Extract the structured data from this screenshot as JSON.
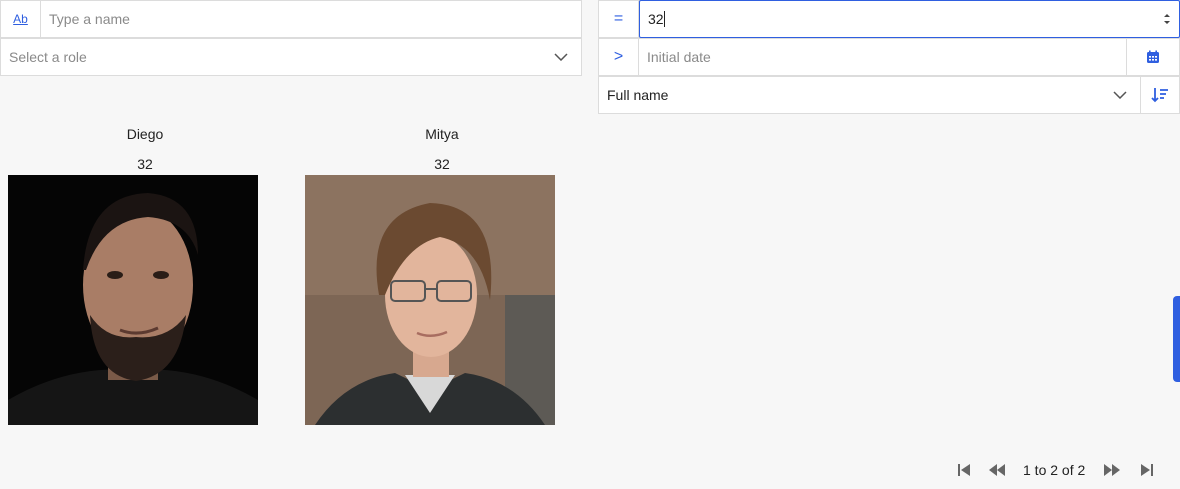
{
  "filters": {
    "name": {
      "placeholder": "Type a name",
      "prefix": "Ab"
    },
    "role": {
      "placeholder": "Select a role"
    },
    "age": {
      "operator": "=",
      "value": "32"
    },
    "date": {
      "operator": ">",
      "placeholder": "Initial date"
    },
    "sort": {
      "value": "Full name"
    }
  },
  "people": [
    {
      "name": "Diego",
      "age": "32"
    },
    {
      "name": "Mitya",
      "age": "32"
    }
  ],
  "pagination": {
    "label": "1 to 2 of 2"
  },
  "colors": {
    "accent": "#2f5fe0",
    "border": "#dcdcdc",
    "background": "#f7f7f7"
  }
}
